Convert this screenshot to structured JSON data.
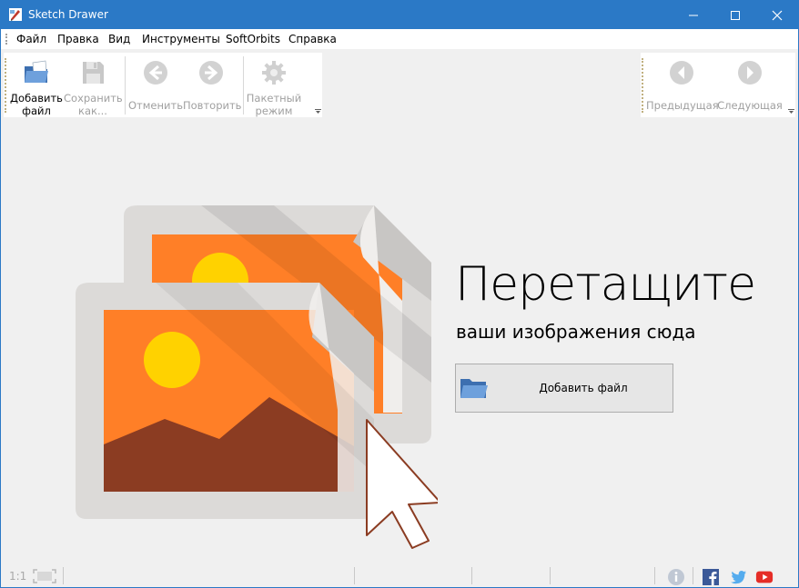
{
  "window": {
    "title": "Sketch Drawer"
  },
  "menu": {
    "items": [
      "Файл",
      "Правка",
      "Вид",
      "Инструменты",
      "SoftOrbits",
      "Справка"
    ]
  },
  "toolbar": {
    "add_file": [
      "Добавить",
      "файл"
    ],
    "save_as": [
      "Сохранить",
      "как..."
    ],
    "undo": "Отменить",
    "redo": "Повторить",
    "batch": [
      "Пакетный",
      "режим"
    ],
    "prev": "Предыдущая",
    "next": "Следующая"
  },
  "main": {
    "title": "Перетащите",
    "subtitle": "ваши изображения сюда",
    "add_button": "Добавить файл"
  },
  "status": {
    "zoom": "1:1"
  },
  "colors": {
    "titlebar": "#2b79c6",
    "orange": "#ff7f27",
    "sun": "#ffd200",
    "mountain": "#8b3c22",
    "frame": "#dcdad8"
  },
  "icons": [
    "app-icon",
    "open-folder-icon",
    "save-icon",
    "undo-icon",
    "redo-icon",
    "gear-icon",
    "prev-icon",
    "next-icon",
    "fit-screen-icon",
    "info-icon",
    "facebook-icon",
    "twitter-icon",
    "youtube-icon",
    "cursor-icon"
  ]
}
